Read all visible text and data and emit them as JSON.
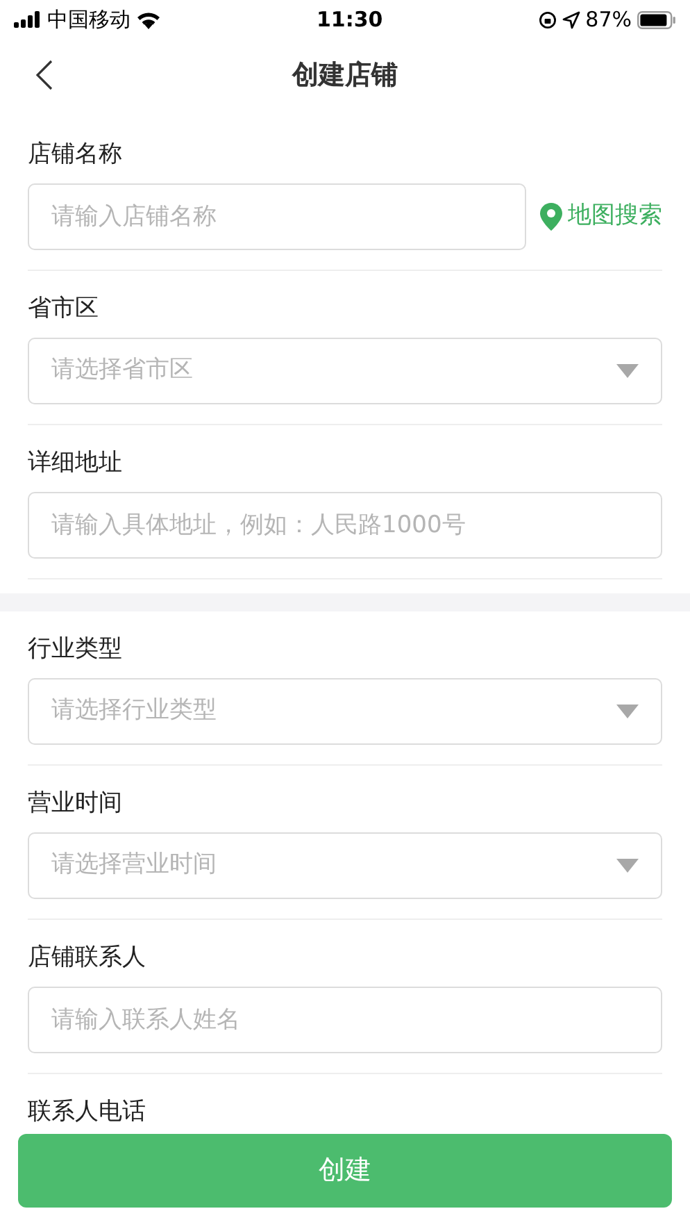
{
  "status_bar": {
    "carrier": "中国移动",
    "time": "11:30",
    "battery": "87%"
  },
  "nav": {
    "title": "创建店铺"
  },
  "groups": [
    [
      {
        "label": "店铺名称",
        "kind": "input",
        "placeholder": "请输入店铺名称",
        "action": "地图搜索"
      },
      {
        "label": "省市区",
        "kind": "select",
        "placeholder": "请选择省市区"
      },
      {
        "label": "详细地址",
        "kind": "input",
        "placeholder": "请输入具体地址，例如：人民路1000号"
      }
    ],
    [
      {
        "label": "行业类型",
        "kind": "select",
        "placeholder": "请选择行业类型"
      },
      {
        "label": "营业时间",
        "kind": "select",
        "placeholder": "请选择营业时间"
      },
      {
        "label": "店铺联系人",
        "kind": "input",
        "placeholder": "请输入联系人姓名"
      },
      {
        "label": "联系人电话",
        "kind": "label"
      }
    ]
  ],
  "submit": "创建"
}
